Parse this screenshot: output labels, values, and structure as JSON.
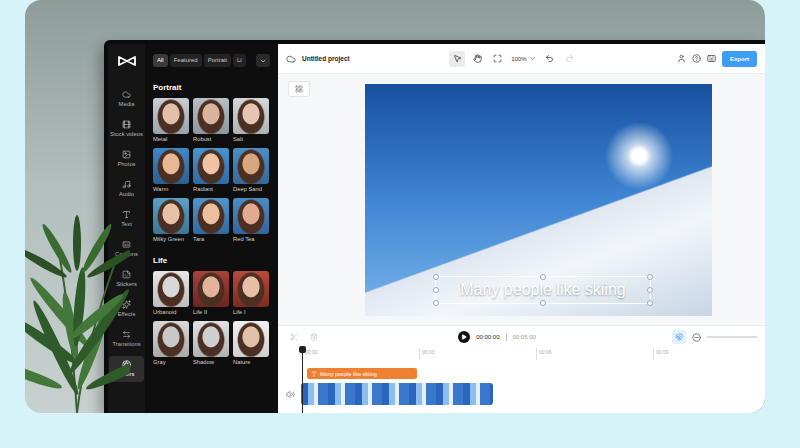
{
  "app": {
    "title": "Untitled project",
    "zoom": "100%",
    "export": "Export"
  },
  "rail": [
    {
      "label": "Media",
      "selected": false
    },
    {
      "label": "Stock videos",
      "selected": false
    },
    {
      "label": "Photos",
      "selected": false
    },
    {
      "label": "Audio",
      "selected": false
    },
    {
      "label": "Text",
      "selected": false
    },
    {
      "label": "Captions",
      "selected": false
    },
    {
      "label": "Stickers",
      "selected": false
    },
    {
      "label": "Effects",
      "selected": false
    },
    {
      "label": "Transitions",
      "selected": false
    },
    {
      "label": "Filters",
      "selected": true
    }
  ],
  "filter_tabs": [
    {
      "label": "All",
      "selected": true
    },
    {
      "label": "Featured",
      "selected": false
    },
    {
      "label": "Portrait",
      "selected": false
    },
    {
      "label": "Li",
      "selected": false
    }
  ],
  "sections": [
    {
      "title": "Portrait",
      "items": [
        "Metal",
        "Robust",
        "Salt",
        "Warm",
        "Radiant",
        "Deep Sand",
        "Milky Green",
        "Tara",
        "Red Tea"
      ]
    },
    {
      "title": "Life",
      "items": [
        "Urbanoid",
        "Life II",
        "Life I",
        "Gray",
        "Shadow",
        "Nature"
      ]
    }
  ],
  "tools": [
    {
      "kind": "select",
      "selected": true
    },
    {
      "kind": "hand",
      "selected": false
    },
    {
      "kind": "fit",
      "selected": false
    }
  ],
  "history": [
    {
      "kind": "undo",
      "disabled": false
    },
    {
      "kind": "redo",
      "disabled": true
    }
  ],
  "canvas": {
    "caption": "Many people like skiing"
  },
  "timeline": {
    "current": "00:00:00",
    "duration": "00:05:00",
    "ruler": [
      "00:00",
      "00:03",
      "00:06",
      "00:09"
    ],
    "tools": [
      {
        "kind": "split",
        "disabled": true
      },
      {
        "kind": "delete",
        "disabled": true
      }
    ],
    "snap": {
      "on": true
    },
    "text_clip": "Many people like skiing"
  }
}
